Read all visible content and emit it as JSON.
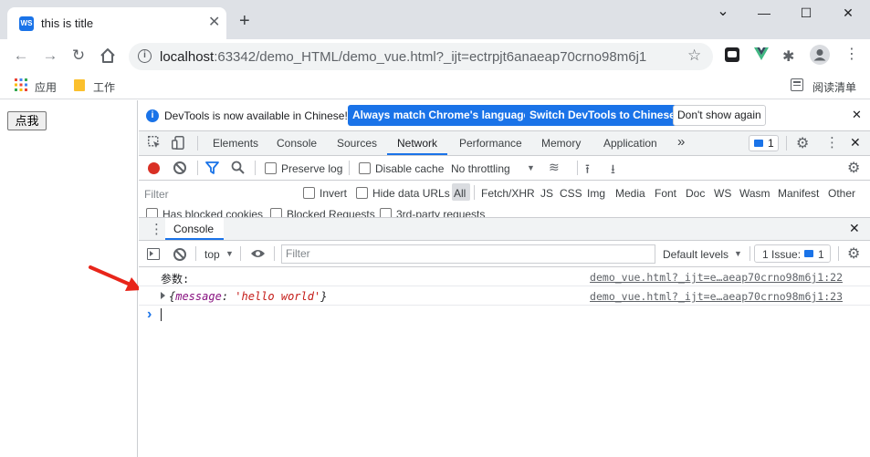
{
  "tab": {
    "favicon_text": "WS",
    "title": "this is title",
    "close": "✕",
    "new_tab": "+"
  },
  "window": {
    "minimize": "—",
    "maximize": "☐",
    "close": "✕",
    "dropdown": "⌄"
  },
  "address": {
    "host": "localhost",
    "path": ":63342/demo_HTML/demo_vue.html?_ijt=ectrpjt6anaeap70crno98m6j1"
  },
  "bookmarks": {
    "apps": "应用",
    "work": "工作",
    "reading_list": "阅读清单"
  },
  "page": {
    "button_label": "点我"
  },
  "devtools": {
    "infobar": {
      "message": "DevTools is now available in Chinese!",
      "match_btn": "Always match Chrome's language",
      "switch_btn": "Switch DevTools to Chinese",
      "dont_show_btn": "Don't show again"
    },
    "tabs": [
      "Elements",
      "Console",
      "Sources",
      "Network",
      "Performance",
      "Memory",
      "Application"
    ],
    "active_tab": "Network",
    "more_tabs": "»",
    "issues_badge": "1",
    "network": {
      "preserve_log": "Preserve log",
      "disable_cache": "Disable cache",
      "throttling": "No throttling",
      "filter_placeholder": "Filter",
      "invert": "Invert",
      "hide_data_urls": "Hide data URLs",
      "types": [
        "All",
        "Fetch/XHR",
        "JS",
        "CSS",
        "Img",
        "Media",
        "Font",
        "Doc",
        "WS",
        "Wasm",
        "Manifest",
        "Other"
      ],
      "has_blocked_cookies": "Has blocked cookies",
      "blocked_requests": "Blocked Requests",
      "third_party": "3rd-party requests"
    },
    "console": {
      "drawer_tab": "Console",
      "context": "top",
      "filter_placeholder": "Filter",
      "levels": "Default levels",
      "issues": "1 Issue:",
      "issues_count": "1",
      "messages": [
        {
          "text": "参数:",
          "source": "demo_vue.html?_ijt=e…aeap70crno98m6j1:22"
        },
        {
          "key": "message",
          "value": "'hello world'",
          "source": "demo_vue.html?_ijt=e…aeap70crno98m6j1:23"
        }
      ],
      "prompt": "›"
    }
  },
  "colors": {
    "accent": "#1a73e8",
    "arrow": "#e8251a",
    "record": "#d93025",
    "vue_green": "#41b883"
  }
}
